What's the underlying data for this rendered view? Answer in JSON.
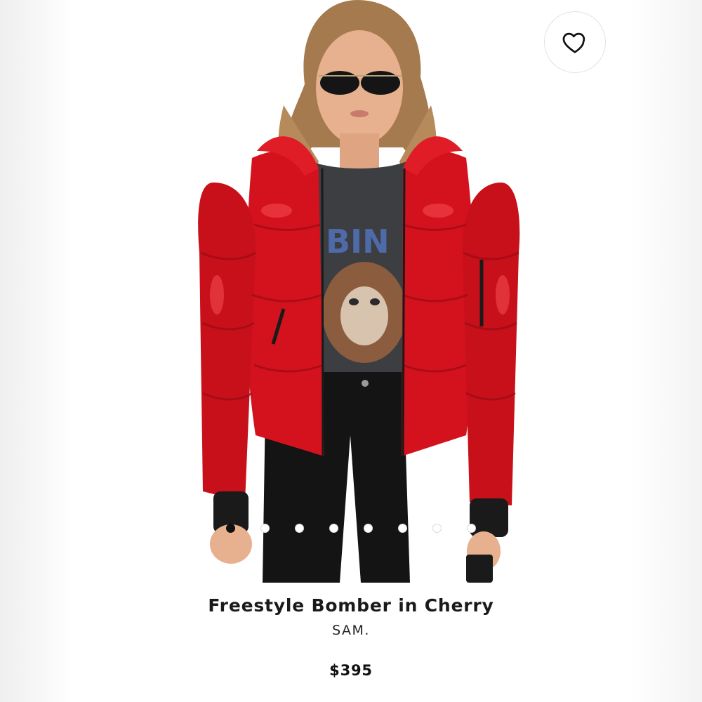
{
  "product": {
    "title": "Freestyle Bomber in Cherry",
    "brand": "SAM.",
    "price": "$395"
  },
  "favorite": {
    "icon": "heart-outline-icon"
  },
  "carousel": {
    "total": 8,
    "active_index": 0
  },
  "image": {
    "description_icon": "product-photo",
    "jacket_color": "#d3121e",
    "pants_color": "#141414"
  }
}
